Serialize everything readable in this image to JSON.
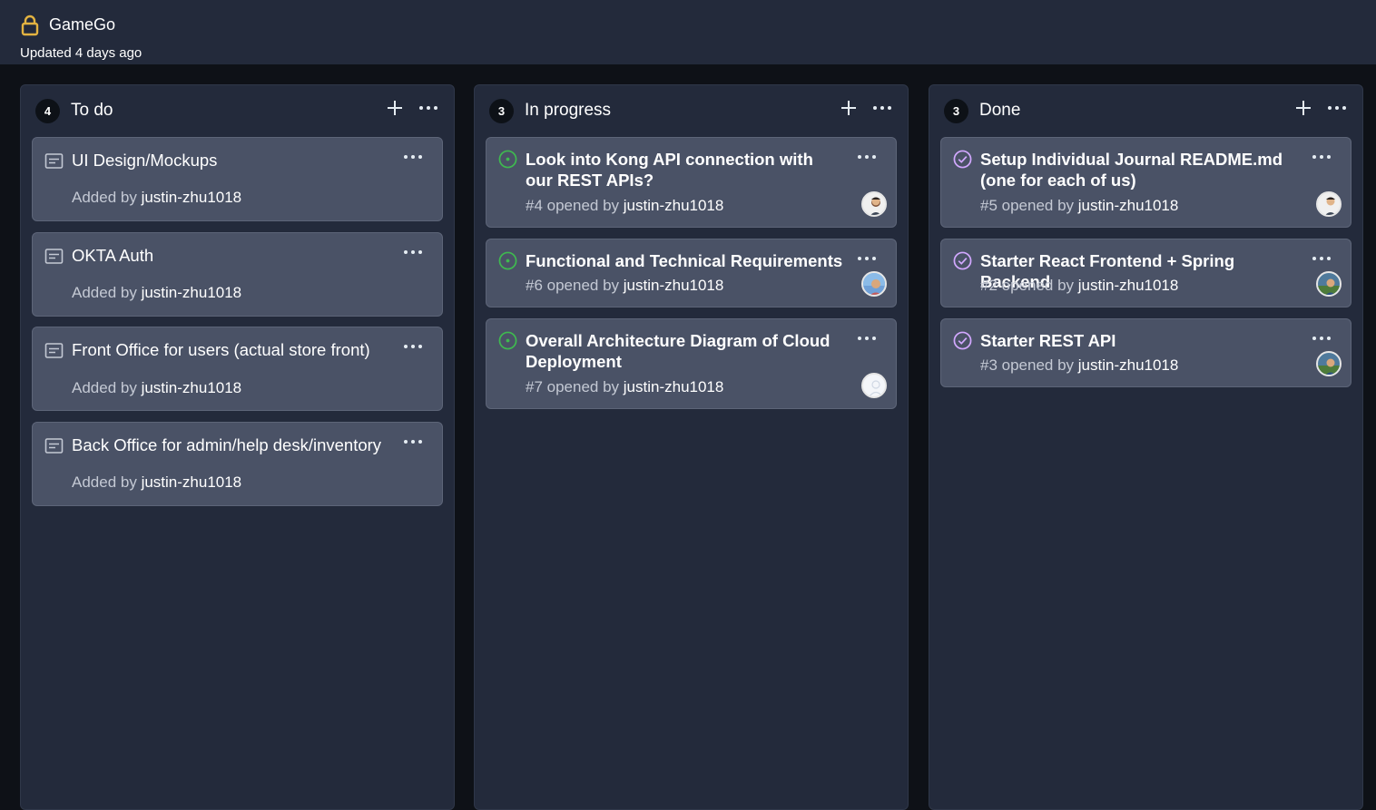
{
  "header": {
    "project_title": "GameGo",
    "updated_text": "Updated 4 days ago"
  },
  "colors": {
    "open_issue": "#3fb950",
    "closed_issue": "#d2a8ff",
    "lock": "#e3b341"
  },
  "columns": [
    {
      "count": "4",
      "title": "To do",
      "cards": [
        {
          "title": "UI Design/Mockups",
          "meta_prefix": "Added by ",
          "user": "justin-zhu1018"
        },
        {
          "title": "OKTA Auth",
          "meta_prefix": "Added by ",
          "user": "justin-zhu1018"
        },
        {
          "title": "Front Office for users (actual store front)",
          "meta_prefix": "Added by ",
          "user": "justin-zhu1018"
        },
        {
          "title": "Back Office for admin/help desk/inventory",
          "meta_prefix": "Added by ",
          "user": "justin-zhu1018"
        }
      ]
    },
    {
      "count": "3",
      "title": "In progress",
      "cards": [
        {
          "title": "Look into Kong API connection with our REST APIs?",
          "meta_prefix": "#4 opened by ",
          "user": "justin-zhu1018"
        },
        {
          "title": "Functional and Technical Requirements",
          "meta_prefix": "#6 opened by ",
          "user": "justin-zhu1018"
        },
        {
          "title": "Overall Architecture Diagram of Cloud Deployment",
          "meta_prefix": "#7 opened by ",
          "user": "justin-zhu1018"
        }
      ]
    },
    {
      "count": "3",
      "title": "Done",
      "cards": [
        {
          "title": "Setup Individual Journal README.md (one for each of us)",
          "meta_prefix": "#5 opened by ",
          "user": "justin-zhu1018"
        },
        {
          "title": "Starter React Frontend + Spring Backend",
          "meta_prefix": "#2 opened by ",
          "user": "justin-zhu1018"
        },
        {
          "title": "Starter REST API",
          "meta_prefix": "#3 opened by ",
          "user": "justin-zhu1018"
        }
      ]
    }
  ]
}
